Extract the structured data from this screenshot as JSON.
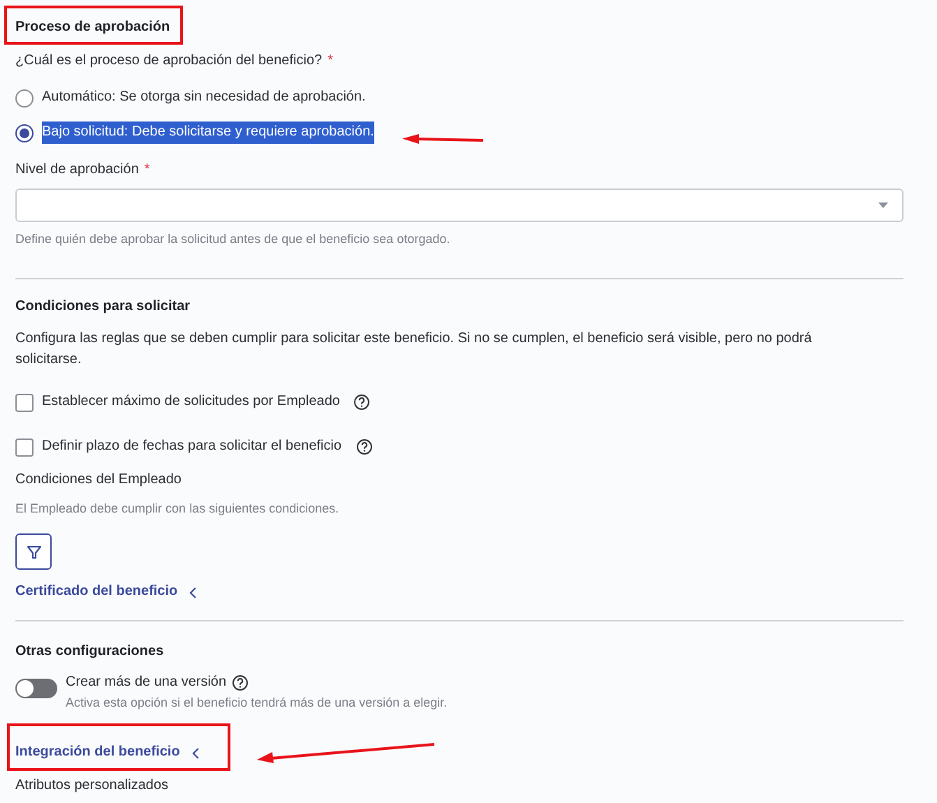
{
  "approval": {
    "title": "Proceso de aprobación",
    "question": {
      "label": "¿Cuál es el proceso de aprobación del beneficio?",
      "required_mark": "*"
    },
    "options": [
      {
        "label": "Automático: Se otorga sin necesidad de aprobación.",
        "selected": false,
        "highlighted": false
      },
      {
        "label": "Bajo solicitud: Debe solicitarse y requiere aprobación.",
        "selected": true,
        "highlighted": true
      }
    ],
    "level_field": {
      "label": "Nivel de aprobación",
      "required_mark": "*",
      "hint": "Define quién debe aprobar la solicitud antes de que el beneficio sea otorgado."
    }
  },
  "conditions": {
    "title": "Condiciones para solicitar",
    "description": "Configura las reglas que se deben cumplir para solicitar este beneficio. Si no se cumplen, el beneficio será visible, pero no podrá solicitarse.",
    "checkboxes": [
      {
        "label": "Establecer máximo de solicitudes por Empleado",
        "checked": false
      },
      {
        "label": "Definir plazo de fechas para solicitar el beneficio",
        "checked": false
      }
    ],
    "employee": {
      "title": "Condiciones del Empleado",
      "hint": "El Empleado debe cumplir con las siguientes condiciones."
    },
    "certificate_link": "Certificado del beneficio"
  },
  "other": {
    "title": "Otras configuraciones",
    "toggle": {
      "label": "Crear más de una versión",
      "hint": "Activa esta opción si el beneficio tendrá más de una versión a elegir.",
      "on": false
    },
    "integration_link": "Integración del beneficio",
    "next_section": "Atributos personalizados"
  }
}
